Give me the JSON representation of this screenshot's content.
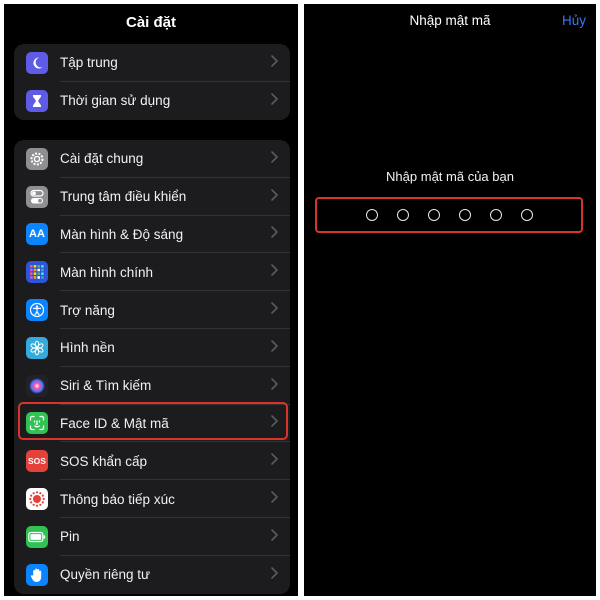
{
  "settings": {
    "title": "Cài đặt",
    "group1": [
      {
        "label": "Tập trung",
        "icon": "moon-icon",
        "color": "#5e5ce6"
      },
      {
        "label": "Thời gian sử dụng",
        "icon": "hourglass-icon",
        "color": "#5e5ce6"
      }
    ],
    "group2": [
      {
        "label": "Cài đặt chung",
        "icon": "gear-icon",
        "color": "#8e8e93"
      },
      {
        "label": "Trung tâm điều khiển",
        "icon": "toggles-icon",
        "color": "#8e8e93"
      },
      {
        "label": "Màn hình & Độ sáng",
        "icon": "text-size-icon",
        "color": "#0a84ff"
      },
      {
        "label": "Màn hình chính",
        "icon": "home-grid-icon",
        "color": "#2c55d8"
      },
      {
        "label": "Trợ năng",
        "icon": "accessibility-icon",
        "color": "#0a84ff"
      },
      {
        "label": "Hình nền",
        "icon": "flower-icon",
        "color": "#35aadc"
      },
      {
        "label": "Siri & Tìm kiếm",
        "icon": "siri-icon",
        "color": "#222226"
      },
      {
        "label": "Face ID & Mật mã",
        "icon": "face-id-icon",
        "color": "#30c353"
      },
      {
        "label": "SOS khẩn cấp",
        "icon": "sos-icon",
        "color": "#e5403a"
      },
      {
        "label": "Thông báo tiếp xúc",
        "icon": "exposure-icon",
        "color": "#ffffff"
      },
      {
        "label": "Pin",
        "icon": "battery-icon",
        "color": "#30c353"
      },
      {
        "label": "Quyền riêng tư",
        "icon": "hand-icon",
        "color": "#0a84ff"
      }
    ],
    "sos_icon_text": "SOS",
    "text_size_icon_text": "AA"
  },
  "passcode": {
    "title": "Nhập mật mã",
    "cancel": "Hủy",
    "prompt": "Nhập mật mã của bạn",
    "digits_total": 6,
    "digits_entered": 0
  },
  "colors": {
    "highlight": "#d9342b",
    "link": "#3478f6"
  }
}
